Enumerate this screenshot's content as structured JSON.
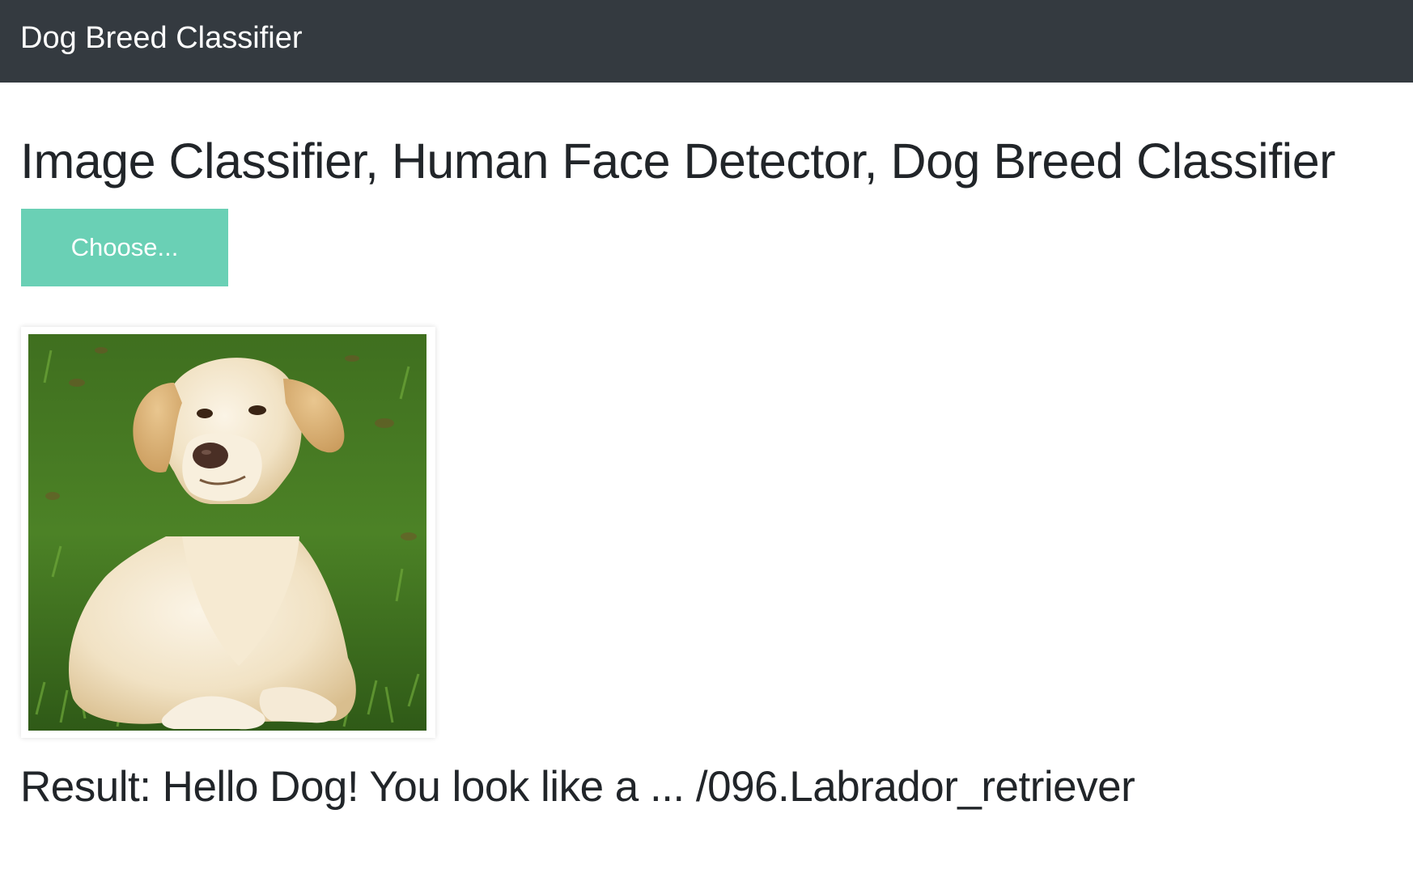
{
  "navbar": {
    "brand": "Dog Breed Classifier"
  },
  "main": {
    "title": "Image Classifier, Human Face Detector, Dog Breed Classifier",
    "choose_button": "Choose...",
    "result_text": "Result: Hello Dog! You look like a ... /096.Labrador_retriever"
  },
  "colors": {
    "navbar_bg": "#343a40",
    "button_bg": "#6ad0b5",
    "text": "#212529"
  }
}
